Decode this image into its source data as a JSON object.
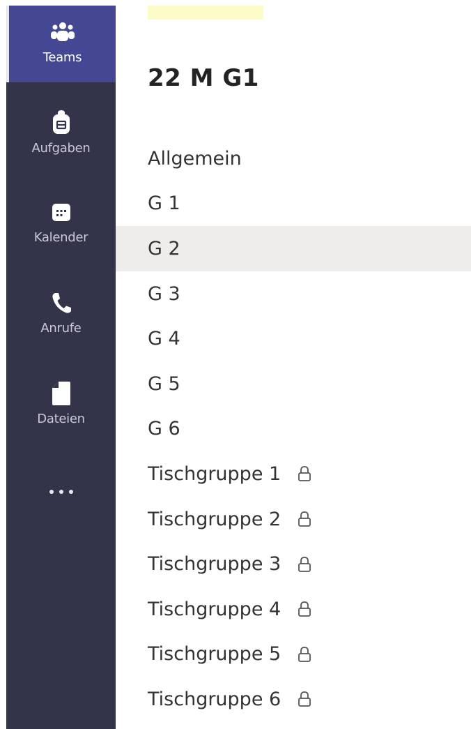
{
  "rail": {
    "items": [
      {
        "label": "Teams",
        "icon": "teams-icon",
        "active": true
      },
      {
        "label": "Aufgaben",
        "icon": "assignments-icon",
        "active": false
      },
      {
        "label": "Kalender",
        "icon": "calendar-icon",
        "active": false
      },
      {
        "label": "Anrufe",
        "icon": "phone-icon",
        "active": false
      },
      {
        "label": "Dateien",
        "icon": "file-icon",
        "active": false
      }
    ],
    "more_icon": "more-icon"
  },
  "team": {
    "title": "22 M G1"
  },
  "channels": [
    {
      "label": "Allgemein",
      "private": false,
      "selected": false
    },
    {
      "label": "G 1",
      "private": false,
      "selected": false
    },
    {
      "label": "G 2",
      "private": false,
      "selected": true
    },
    {
      "label": "G 3",
      "private": false,
      "selected": false
    },
    {
      "label": "G 4",
      "private": false,
      "selected": false
    },
    {
      "label": "G 5",
      "private": false,
      "selected": false
    },
    {
      "label": "G 6",
      "private": false,
      "selected": false
    },
    {
      "label": "Tischgruppe 1",
      "private": true,
      "selected": false
    },
    {
      "label": "Tischgruppe 2",
      "private": true,
      "selected": false
    },
    {
      "label": "Tischgruppe 3",
      "private": true,
      "selected": false
    },
    {
      "label": "Tischgruppe 4",
      "private": true,
      "selected": false
    },
    {
      "label": "Tischgruppe 5",
      "private": true,
      "selected": false
    },
    {
      "label": "Tischgruppe 6",
      "private": true,
      "selected": false
    }
  ],
  "colors": {
    "rail_background": "#33344a",
    "rail_active": "#444791",
    "selected_row": "#efedeb",
    "highlight_tab": "#fdfbc8"
  }
}
